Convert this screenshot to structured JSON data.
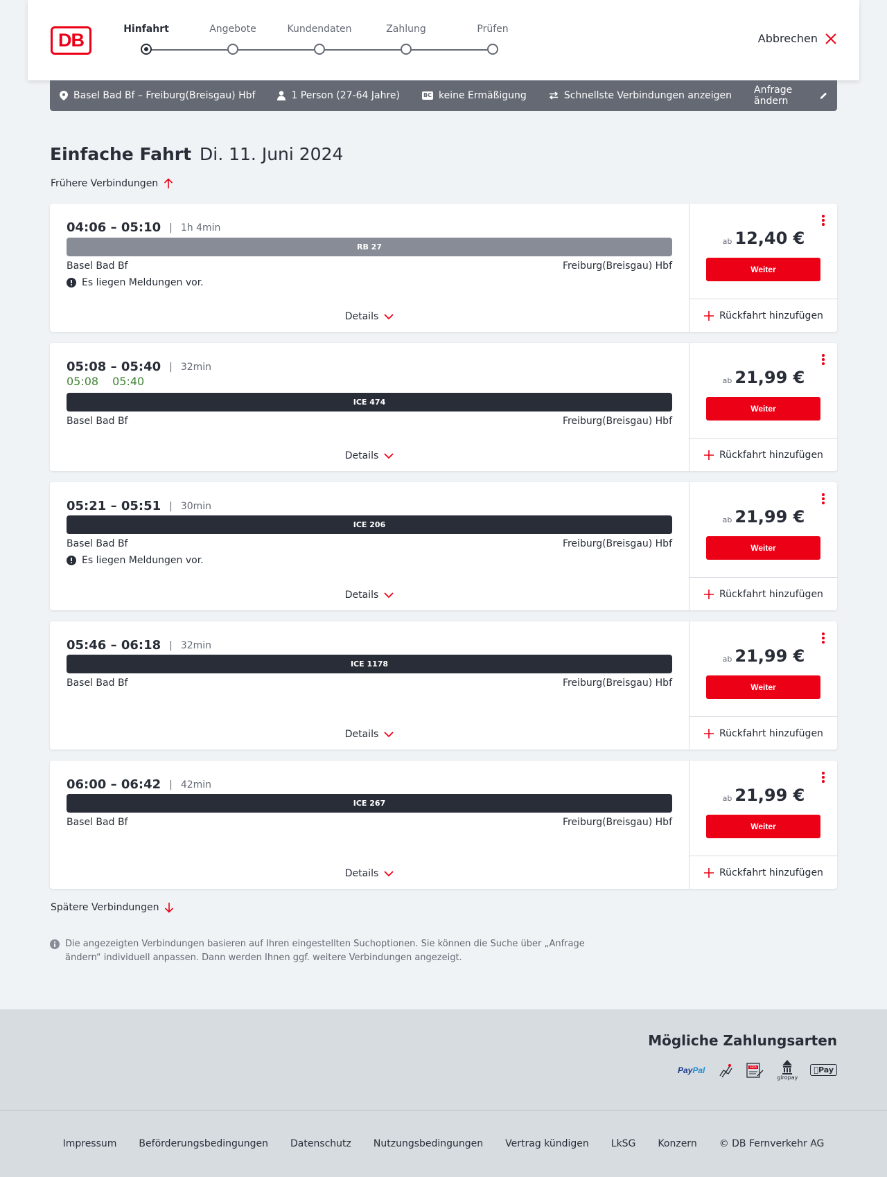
{
  "header": {
    "logo_text": "DB",
    "steps": [
      "Hinfahrt",
      "Angebote",
      "Kundendaten",
      "Zahlung",
      "Prüfen"
    ],
    "active_step": 0,
    "cancel_label": "Abbrechen"
  },
  "search": {
    "route": "Basel Bad Bf – Freiburg(Breisgau) Hbf",
    "passengers": "1 Person (27-64 Jahre)",
    "bc_badge": "BC",
    "discount": "keine Ermäßigung",
    "fastest": "Schnellste Verbindungen anzeigen",
    "change_label": "Anfrage ändern"
  },
  "page": {
    "title": "Einfache Fahrt",
    "date": "Di. 11. Juni 2024",
    "earlier_label": "Frühere Verbindungen",
    "later_label": "Spätere Verbindungen",
    "info_text": "Die angezeigten Verbindungen basieren auf Ihren eingestellten Suchoptionen. Sie können die Suche über „Anfrage ändern“ individuell anpassen. Dann werden Ihnen ggf. weitere Verbindungen angezeigt."
  },
  "labels": {
    "details": "Details",
    "ab": "ab",
    "weiter": "Weiter",
    "return": "Rückfahrt hinzufügen",
    "sep": "|"
  },
  "connections": [
    {
      "times": "04:06 – 05:10",
      "duration": "1h 4min",
      "train": "RB 27",
      "from": "Basel Bad Bf",
      "to": "Freiburg(Breisgau) Hbf",
      "notice": "Es liegen Meldungen vor.",
      "price": "12,40 €"
    },
    {
      "times": "05:08 – 05:40",
      "duration": "32min",
      "realtime_dep": "05:08",
      "realtime_arr": "05:40",
      "train": "ICE 474",
      "from": "Basel Bad Bf",
      "to": "Freiburg(Breisgau) Hbf",
      "price": "21,99 €"
    },
    {
      "times": "05:21 – 05:51",
      "duration": "30min",
      "train": "ICE 206",
      "from": "Basel Bad Bf",
      "to": "Freiburg(Breisgau) Hbf",
      "notice": "Es liegen Meldungen vor.",
      "price": "21,99 €"
    },
    {
      "times": "05:46 – 06:18",
      "duration": "32min",
      "train": "ICE 1178",
      "from": "Basel Bad Bf",
      "to": "Freiburg(Breisgau) Hbf",
      "price": "21,99 €"
    },
    {
      "times": "06:00 – 06:42",
      "duration": "42min",
      "train": "ICE 267",
      "from": "Basel Bad Bf",
      "to": "Freiburg(Breisgau) Hbf",
      "price": "21,99 €"
    }
  ],
  "payment": {
    "title": "Mögliche Zahlungsarten",
    "paypal_pay": "Pay",
    "paypal_pal": "Pal",
    "sepa": "SEPA",
    "giropay": "giropay",
    "applepay": "Pay"
  },
  "footer": {
    "links": [
      "Impressum",
      "Beförderungsbedingungen",
      "Datenschutz",
      "Nutzungsbedingungen",
      "Vertrag kündigen",
      "LkSG",
      "Konzern",
      "© DB Fernverkehr AG"
    ]
  },
  "colors": {
    "brand_red": "#ec0016",
    "text": "#282d37",
    "realtime_green": "#408335",
    "bar_gray": "#646973"
  }
}
